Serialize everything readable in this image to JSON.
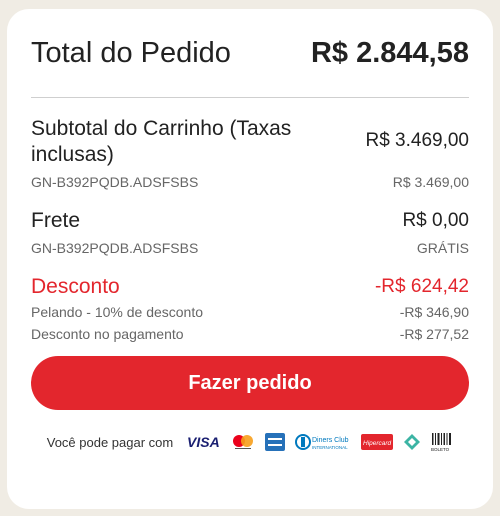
{
  "total": {
    "label": "Total do Pedido",
    "value": "R$ 2.844,58"
  },
  "subtotal": {
    "label": "Subtotal do Carrinho (Taxas inclusas)",
    "value": "R$ 3.469,00",
    "sku": "GN-B392PQDB.ADSFSBS",
    "sku_value": "R$ 3.469,00"
  },
  "shipping": {
    "label": "Frete",
    "value": "R$ 0,00",
    "sku": "GN-B392PQDB.ADSFSBS",
    "sku_value": "GRÁTIS"
  },
  "discount": {
    "label": "Desconto",
    "value": "-R$ 624,42",
    "items": [
      {
        "label": "Pelando - 10% de desconto",
        "value": "-R$ 346,90"
      },
      {
        "label": "Desconto no pagamento",
        "value": "-R$ 277,52"
      }
    ]
  },
  "order_button": {
    "label": "Fazer pedido"
  },
  "payment": {
    "label": "Você pode pagar com",
    "visa_text": "VISA",
    "diners_text": "Diners Club",
    "diners_sub": "INTERNATIONAL",
    "hipercard_text": "Hipercard",
    "boleto_text": "BOLETO",
    "icons": [
      "visa-icon",
      "mastercard-icon",
      "amex-icon",
      "diners-club-icon",
      "hipercard-icon",
      "elo-icon",
      "boleto-icon"
    ]
  },
  "colors": {
    "accent": "#e3262d",
    "background": "#f0ece4",
    "card": "#ffffff"
  }
}
